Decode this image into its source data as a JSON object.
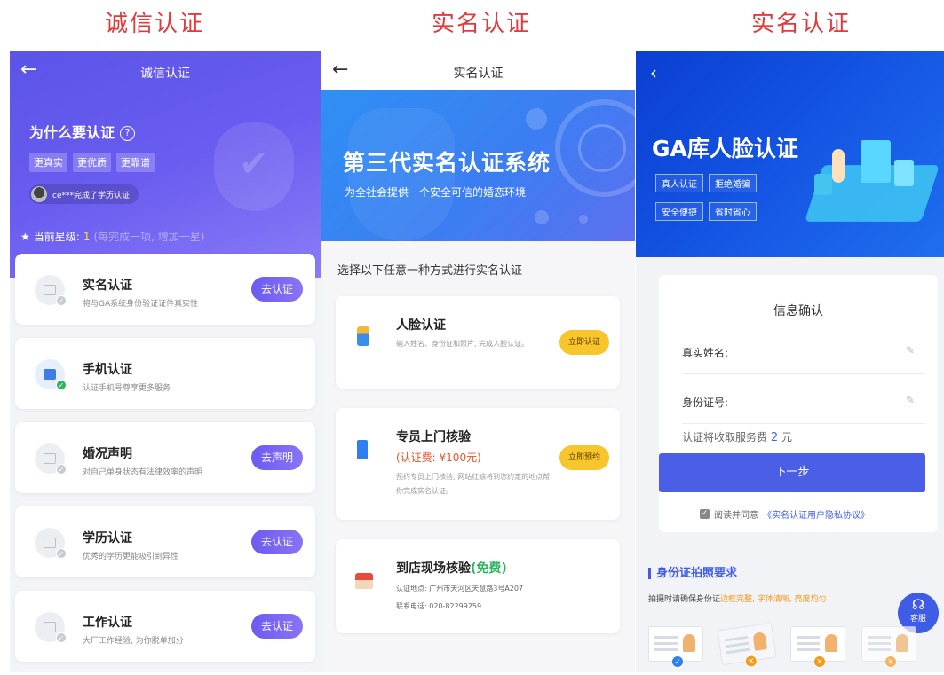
{
  "captions": [
    "诚信认证",
    "实名认证",
    "实名认证"
  ],
  "screen1": {
    "title": "诚信认证",
    "why": "为什么要认证",
    "tags": [
      "更真实",
      "更优质",
      "更靠谱"
    ],
    "notice": "ce***完成了学历认证",
    "level_label": "当前星级:",
    "level_value": "1",
    "level_hint": "(每完成一项, 增加一星)",
    "items": [
      {
        "title": "实名认证",
        "desc": "将与GA系统身份验证证件真实性",
        "button": "去认证"
      },
      {
        "title": "手机认证",
        "desc": "认证手机号尊享更多服务",
        "button": ""
      },
      {
        "title": "婚况声明",
        "desc": "对自己单身状态有法律效率的声明",
        "button": "去声明"
      },
      {
        "title": "学历认证",
        "desc": "优秀的学历更能吸引到异性",
        "button": "去认证"
      },
      {
        "title": "工作认证",
        "desc": "大厂工作经验, 为你脱单加分",
        "button": "去认证"
      }
    ]
  },
  "screen2": {
    "title": "实名认证",
    "banner_title": "第三代实名认证系统",
    "banner_sub": "为全社会提供一个安全可信的婚恋环境",
    "choose": "选择以下任意一种方式进行实名认证",
    "face": {
      "title": "人脸认证",
      "desc": "输入姓名、身份证和照片, 完成人脸认证。",
      "button": "立即认证"
    },
    "visit": {
      "title": "专员上门核验",
      "fee": "(认证费: ¥100元)",
      "desc": "预约专员上门核验, 网站红娘将到您约定的地点帮你完成实名认证。",
      "button": "立即预约"
    },
    "store": {
      "title": "到店现场核验",
      "free": "(免费)",
      "address": "认证地点: 广州市天河区天慧路3号A207",
      "phone": "联系电话: 020-82299259"
    }
  },
  "screen3": {
    "back": "‹",
    "banner_title": "GA库人脸认证",
    "tags_row1": [
      "真人认证",
      "拒绝婚骗"
    ],
    "tags_row2": [
      "安全便捷",
      "省时省心"
    ],
    "form_title": "信息确认",
    "name_label": "真实姓名:",
    "id_label": "身份证号:",
    "fee_prefix": "认证将收取服务费",
    "fee_amount": "2",
    "fee_unit": "元",
    "next_button": "下一步",
    "agree_prefix": "阅读并同意",
    "agree_link": "《实名认证用户隐私协议》",
    "req_title": "身份证拍照要求",
    "req_prefix": "拍摄时请确保身份证",
    "req_highlight": "边框完整, 字体清晰, 亮度均匀",
    "service_label": "客服"
  }
}
